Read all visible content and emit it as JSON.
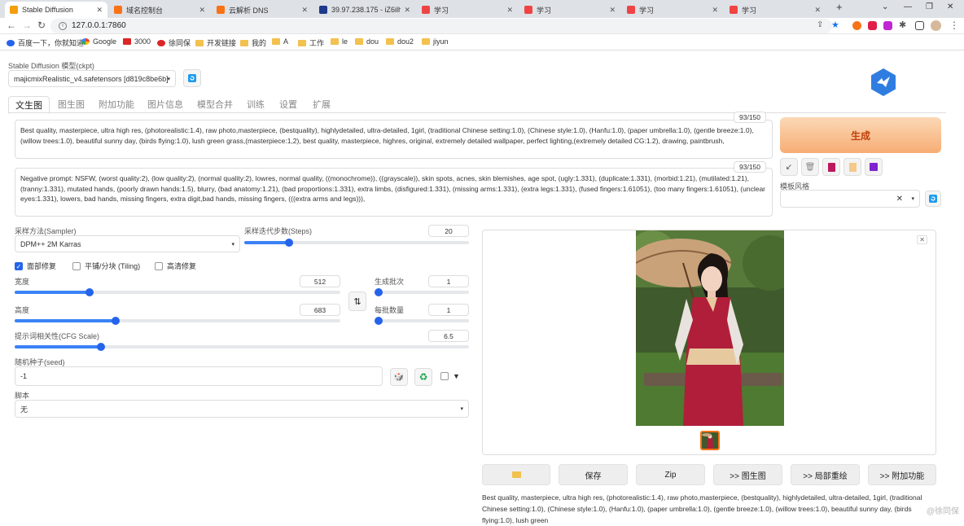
{
  "browser": {
    "tabs": [
      {
        "title": "Stable Diffusion",
        "color": "#f59e0b"
      },
      {
        "title": "域名控制台",
        "color": "#f97316"
      },
      {
        "title": "云解析 DNS",
        "color": "#f97316"
      },
      {
        "title": "39.97.238.175 - iZ6ilh61",
        "color": "#1e3a8a"
      },
      {
        "title": "学习",
        "color": "#ef4444"
      },
      {
        "title": "学习",
        "color": "#ef4444"
      },
      {
        "title": "学习",
        "color": "#ef4444"
      },
      {
        "title": "学习",
        "color": "#ef4444"
      }
    ],
    "url": "127.0.0.1:7860",
    "bookmarks": [
      {
        "label": "百度一下，你就知道",
        "icon": "paw-icon"
      },
      {
        "label": "Google",
        "icon": "google-icon"
      },
      {
        "label": "3000",
        "icon": "red-page-icon"
      },
      {
        "label": "徐同保",
        "icon": "red-c-icon"
      },
      {
        "label": "开发链接",
        "icon": "folder-icon"
      },
      {
        "label": "我的",
        "icon": "folder-icon"
      },
      {
        "label": "A",
        "icon": "folder-icon"
      },
      {
        "label": "工作",
        "icon": "folder-icon"
      },
      {
        "label": "le",
        "icon": "folder-icon"
      },
      {
        "label": "dou",
        "icon": "folder-icon"
      },
      {
        "label": "dou2",
        "icon": "folder-icon"
      },
      {
        "label": "jiyun",
        "icon": "folder-icon"
      }
    ]
  },
  "model": {
    "label": "Stable Diffusion 模型(ckpt)",
    "value": "majicmixRealistic_v4.safetensors [d819c8be6b]"
  },
  "tabs": [
    "文生图",
    "图生图",
    "附加功能",
    "图片信息",
    "模型合并",
    "训练",
    "设置",
    "扩展"
  ],
  "prompt": {
    "text": "Best quality, masterpiece, ultra high res, (photorealistic:1.4), raw photo,masterpiece, (bestquality), highlydetailed, ultra-detailed, 1girl, (traditional Chinese setting:1.0), (Chinese style:1.0), (Hanfu:1.0), (paper umbrella:1.0), (gentle breeze:1.0), (willow trees:1.0), beautiful sunny day, (birds flying:1.0), lush green grass,(masterpiece:1,2), best quality, masterpiece, highres, original, extremely detailed wallpaper, perfect lighting,(extremely detailed CG:1.2), drawing, paintbrush,",
    "counter": "93/150"
  },
  "negative": {
    "text": "Negative prompt: NSFW, (worst quality:2), (low quality:2), (normal quality:2), lowres, normal quality, ((monochrome)), ((grayscale)), skin spots, acnes, skin blemishes, age spot, (ugly:1.331), (duplicate:1.331), (morbid:1.21), (mutilated:1.21), (tranny:1.331), mutated hands, (poorly drawn hands:1.5), blurry, (bad anatomy:1.21), (bad proportions:1.331), extra limbs, (disfigured:1.331), (missing arms:1.331), (extra legs:1.331), (fused fingers:1.61051), (too many fingers:1.61051), (unclear eyes:1.331), lowers, bad hands, missing fingers, extra digit,bad hands, missing fingers, (((extra arms and legs))),",
    "counter": "93/150"
  },
  "generate_label": "生成",
  "style": {
    "label": "模板风格"
  },
  "sampler": {
    "label": "采样方法(Sampler)",
    "value": "DPM++ 2M Karras"
  },
  "steps": {
    "label": "采样迭代步数(Steps)",
    "value": "20",
    "fraction": 0.2
  },
  "checks": [
    {
      "label": "面部修复",
      "checked": true
    },
    {
      "label": "平铺/分块 (Tiling)",
      "checked": false
    },
    {
      "label": "高清修复",
      "checked": false
    }
  ],
  "width": {
    "label": "宽度",
    "value": "512",
    "fraction": 0.23
  },
  "height": {
    "label": "高度",
    "value": "683",
    "fraction": 0.31
  },
  "batch_count": {
    "label": "生成批次",
    "value": "1",
    "fraction": 0.0
  },
  "batch_size": {
    "label": "每批数量",
    "value": "1",
    "fraction": 0.0
  },
  "cfg": {
    "label": "提示词相关性(CFG Scale)",
    "value": "6.5",
    "fraction": 0.19
  },
  "seed": {
    "label": "随机种子(seed)",
    "value": "-1"
  },
  "script": {
    "label": "脚本",
    "value": "无"
  },
  "actions": [
    "保存",
    "Zip",
    ">> 图生图",
    ">> 局部重绘",
    ">> 附加功能"
  ],
  "output_info": "Best quality, masterpiece, ultra high res, (photorealistic:1.4), raw photo,masterpiece, (bestquality), highlydetailed, ultra-detailed, 1girl, (traditional Chinese setting:1.0), (Chinese style:1.0), (Hanfu:1.0), (paper umbrella:1.0), (gentle breeze:1.0), (willow trees:1.0), beautiful sunny day, (birds flying:1.0), lush green",
  "watermark": "@徐同保",
  "colors": {
    "accent": "#2563eb",
    "generate": "#f7ad74",
    "generate_text": "#c2410c"
  }
}
